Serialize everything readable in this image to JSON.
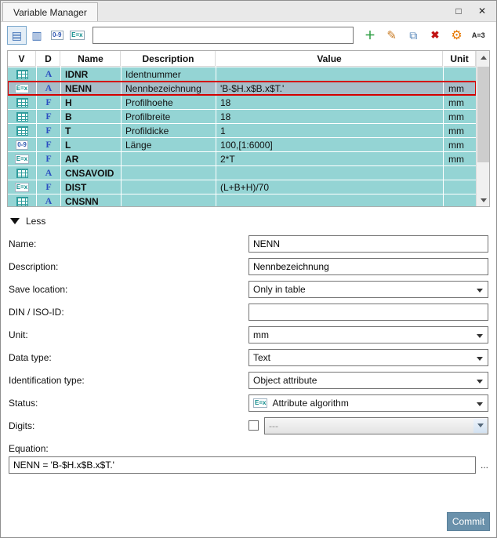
{
  "window": {
    "title": "Variable Manager"
  },
  "icons": {
    "maximize": "□",
    "close": "✕",
    "view_list": "▤",
    "view_columns": "▥",
    "digits": "0-9",
    "formula": "E=x",
    "add": "＋",
    "edit": "✎",
    "copy": "⧉",
    "delete": "✖",
    "settings": "⚙",
    "a3": "A=3",
    "more": "..."
  },
  "colors": {
    "row_teal": "#94d4d4",
    "selected_row": "#a6bdc8",
    "selection_border": "#d40000",
    "commit_button": "#6a91ab"
  },
  "toolbar": {
    "filter_value": ""
  },
  "table": {
    "columns": [
      "V",
      "D",
      "Name",
      "Description",
      "Value",
      "Unit"
    ],
    "rows": [
      {
        "v_icon": "table",
        "d": "A",
        "name": "IDNR",
        "description": "Identnummer",
        "value": "",
        "unit": "",
        "selected": false
      },
      {
        "v_icon": "formula",
        "d": "A",
        "name": "NENN",
        "description": "Nennbezeichnung",
        "value": "'B-$H.x$B.x$T.'",
        "unit": "mm",
        "selected": true
      },
      {
        "v_icon": "table",
        "d": "F",
        "name": "H",
        "description": "Profilhoehe",
        "value": "18",
        "unit": "mm",
        "selected": false
      },
      {
        "v_icon": "table",
        "d": "F",
        "name": "B",
        "description": "Profilbreite",
        "value": "18",
        "unit": "mm",
        "selected": false
      },
      {
        "v_icon": "table",
        "d": "F",
        "name": "T",
        "description": "Profildicke",
        "value": "1",
        "unit": "mm",
        "selected": false
      },
      {
        "v_icon": "digits",
        "d": "F",
        "name": "L",
        "description": "Länge",
        "value": "100,[1:6000]",
        "unit": "mm",
        "selected": false
      },
      {
        "v_icon": "formula",
        "d": "F",
        "name": "AR",
        "description": "",
        "value": "2*T",
        "unit": "mm",
        "selected": false
      },
      {
        "v_icon": "table",
        "d": "A",
        "name": "CNSAVOID",
        "description": "",
        "value": "",
        "unit": "",
        "selected": false
      },
      {
        "v_icon": "formula",
        "d": "F",
        "name": "DIST",
        "description": "",
        "value": "(L+B+H)/70",
        "unit": "",
        "selected": false
      },
      {
        "v_icon": "table",
        "d": "A",
        "name": "CNSNN",
        "description": "",
        "value": "",
        "unit": "",
        "selected": false
      }
    ]
  },
  "collapse": {
    "label": "Less"
  },
  "form": {
    "name": {
      "label": "Name:",
      "value": "NENN"
    },
    "description": {
      "label": "Description:",
      "value": "Nennbezeichnung"
    },
    "save_location": {
      "label": "Save location:",
      "value": "Only in table"
    },
    "din_iso": {
      "label": "DIN / ISO-ID:",
      "value": ""
    },
    "unit": {
      "label": "Unit:",
      "value": "mm"
    },
    "data_type": {
      "label": "Data type:",
      "value": "Text"
    },
    "identification_type": {
      "label": "Identification type:",
      "value": "Object attribute"
    },
    "status": {
      "label": "Status:",
      "value": "Attribute algorithm"
    },
    "digits": {
      "label": "Digits:",
      "value": "---",
      "checked": false
    },
    "equation": {
      "label": "Equation:",
      "value": "NENN = 'B-$H.x$B.x$T.'"
    }
  },
  "footer": {
    "commit_label": "Commit"
  }
}
